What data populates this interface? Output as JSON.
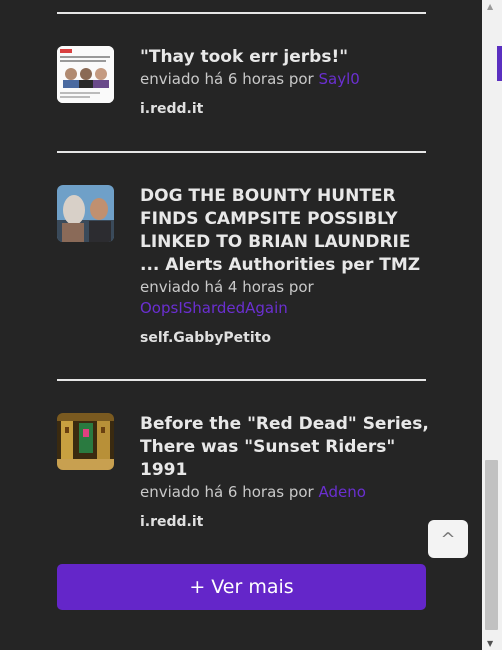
{
  "posts": [
    {
      "title": "\"Thay took err jerbs!\"",
      "meta_prefix": "enviado há 6 horas por ",
      "user": "Sayl0",
      "domain": "i.redd.it",
      "thumb": "meme-screenshot"
    },
    {
      "title": "DOG THE BOUNTY HUNTER FINDS CAMPSITE POSSIBLY LINKED TO BRIAN LAUNDRIE ... Alerts Authorities per TMZ",
      "meta_prefix": "enviado há 4 horas por ",
      "user": "OopsIShardedAgain",
      "domain": "self.GabbyPetito",
      "thumb": "photo-two-men"
    },
    {
      "title": "Before the \"Red Dead\" Series, There was \"Sunset Riders\" 1991",
      "meta_prefix": "enviado há 6 horas por ",
      "user": "Adeno",
      "domain": "i.redd.it",
      "thumb": "pixel-game-screenshot"
    }
  ],
  "more_button": "+ Ver mais",
  "scroll_top_glyph": "^",
  "colors": {
    "background": "#252525",
    "accent": "#6426c9",
    "username": "#6a2fd0"
  }
}
